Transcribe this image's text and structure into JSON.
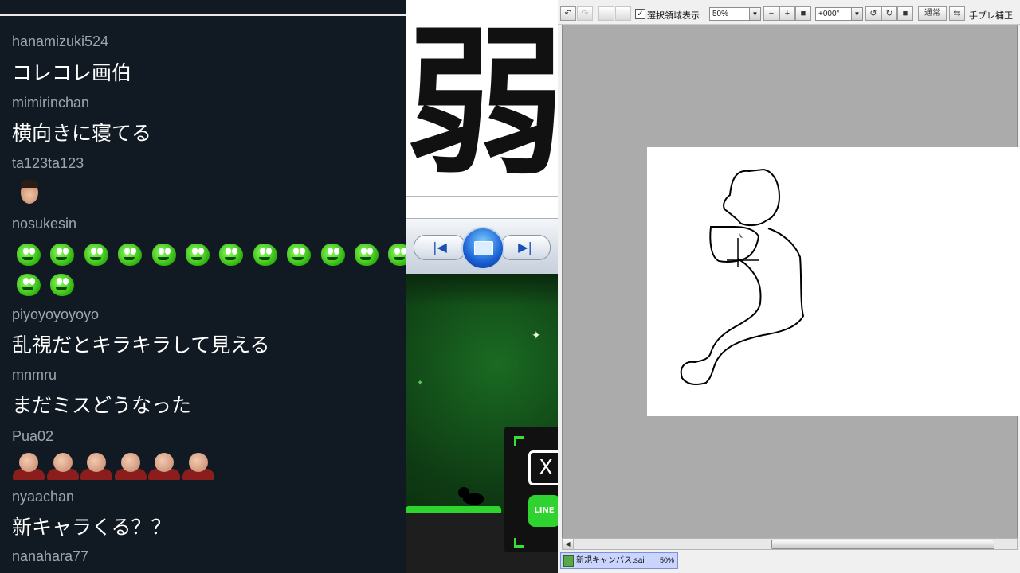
{
  "chat": {
    "messages": [
      {
        "user": "hanamizuki524",
        "text": "コレコレ画伯"
      },
      {
        "user": "mimirinchan",
        "text": "横向きに寝てる"
      },
      {
        "user": "ta123ta123",
        "emote": "face-emote"
      },
      {
        "user": "nosukesin",
        "emote": "green-emote",
        "emote_count": 14
      },
      {
        "user": "piyoyoyoyoyo",
        "text": "乱視だとキラキラして見える"
      },
      {
        "user": "mnmru",
        "text": "まだミスどうなった"
      },
      {
        "user": "Pua02",
        "emote": "bald-emote",
        "emote_count": 6
      },
      {
        "user": "nyaachan",
        "text": "新キャラくる？？"
      },
      {
        "user": "nanahara77",
        "text": ""
      }
    ]
  },
  "middle": {
    "kanji": "弱",
    "player": {
      "prev_icon": "skip-previous-icon",
      "prev_glyph": "|◀",
      "center_icon": "screen-icon",
      "next_icon": "skip-next-icon",
      "next_glyph": "▶|"
    },
    "share": {
      "x_label": "X",
      "line_label": "LINE"
    }
  },
  "sai": {
    "toolbar": {
      "undo": "↶",
      "redo": "↷",
      "select_visible_label": "選択領域表示",
      "zoom": "50%",
      "minus": "−",
      "plus": "+",
      "stop": "■",
      "angle": "+000°",
      "rotate_left": "↺",
      "rotate_right": "↻",
      "rotate_reset": "■",
      "mode": "通常",
      "stabilizer_label": "手ブレ補正"
    },
    "document": {
      "name": "新規キャンバス.sai",
      "zoom": "50%"
    }
  }
}
